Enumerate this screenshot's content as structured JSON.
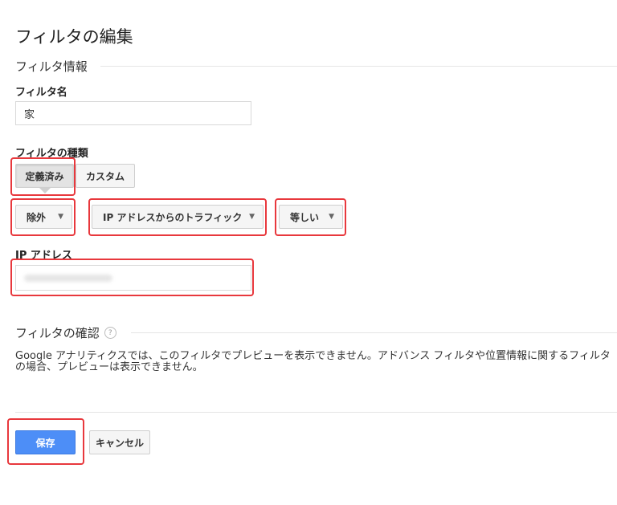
{
  "page": {
    "title": "フィルタの編集"
  },
  "filter_info": {
    "section_title": "フィルタ情報",
    "name_label": "フィルタ名",
    "name_value": "家",
    "type_label": "フィルタの種類",
    "type_tabs": [
      "定義済み",
      "カスタム"
    ],
    "selected_tab": "定義済み",
    "action_select": "除外",
    "source_select": "IP アドレスからのトラフィック",
    "operator_select": "等しい",
    "ip_label": "IP アドレス",
    "ip_value": ""
  },
  "verify": {
    "section_title": "フィルタの確認",
    "help_symbol": "?",
    "notice": "Google アナリティクスでは、このフィルタでプレビューを表示できません。アドバンス フィルタや位置情報に関するフィルタの場合、プレビューは表示できません。"
  },
  "footer": {
    "save_label": "保存",
    "cancel_label": "キャンセル"
  },
  "colors": {
    "primary": "#4d8ef7",
    "highlight": "#e8383d"
  }
}
